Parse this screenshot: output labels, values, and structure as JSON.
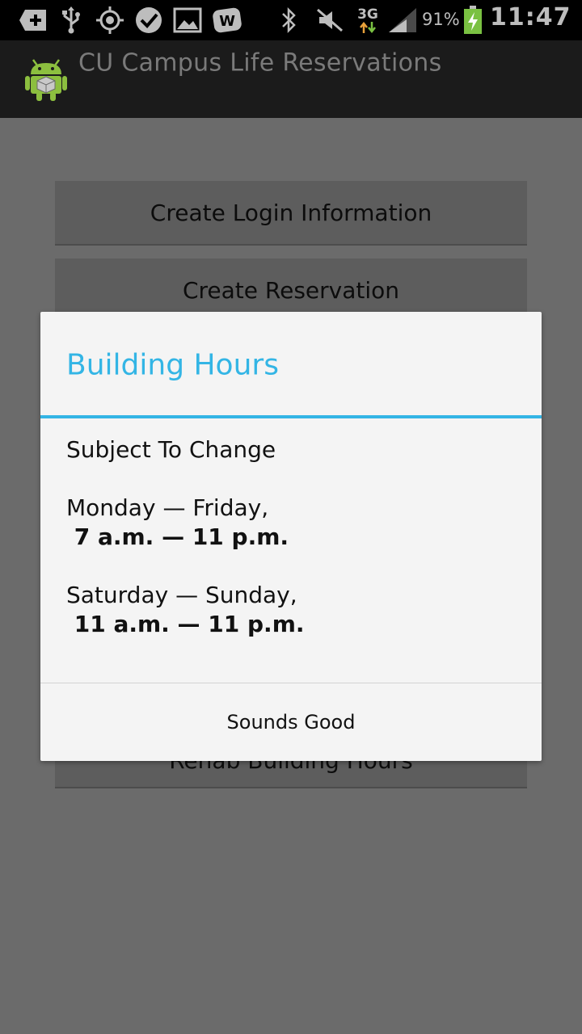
{
  "status_bar": {
    "icons": [
      "add-notification-icon",
      "usb-icon",
      "gps-icon",
      "check-notification-icon",
      "image-icon",
      "w-app-icon",
      "bluetooth-icon",
      "mute-icon",
      "data-3g-icon",
      "signal-icon",
      "battery-charging-icon"
    ],
    "network": "3G",
    "battery": "91%",
    "time": "11:47"
  },
  "action_bar": {
    "app_icon": "android-app-icon",
    "title": "CU Campus Life Reservations"
  },
  "main": {
    "buttons": [
      {
        "label": "Create Login Information"
      },
      {
        "label": "Create Reservation"
      },
      {
        "label": "Rehab Building Hours"
      }
    ]
  },
  "dialog": {
    "title": "Building Hours",
    "lines": [
      "Subject To Change",
      "Monday — Friday,",
      " 7 a.m. — 11 p.m.",
      "Saturday — Sunday,",
      " 11 a.m. — 11 p.m."
    ],
    "button_label": "Sounds Good"
  },
  "colors": {
    "accent": "#33b5e5",
    "status_bar": "#000000",
    "action_bar": "#1b1b1b",
    "dialog_bg": "#f4f4f4",
    "scrim_bg": "#6b6b6b",
    "battery_green": "#7ac142"
  }
}
